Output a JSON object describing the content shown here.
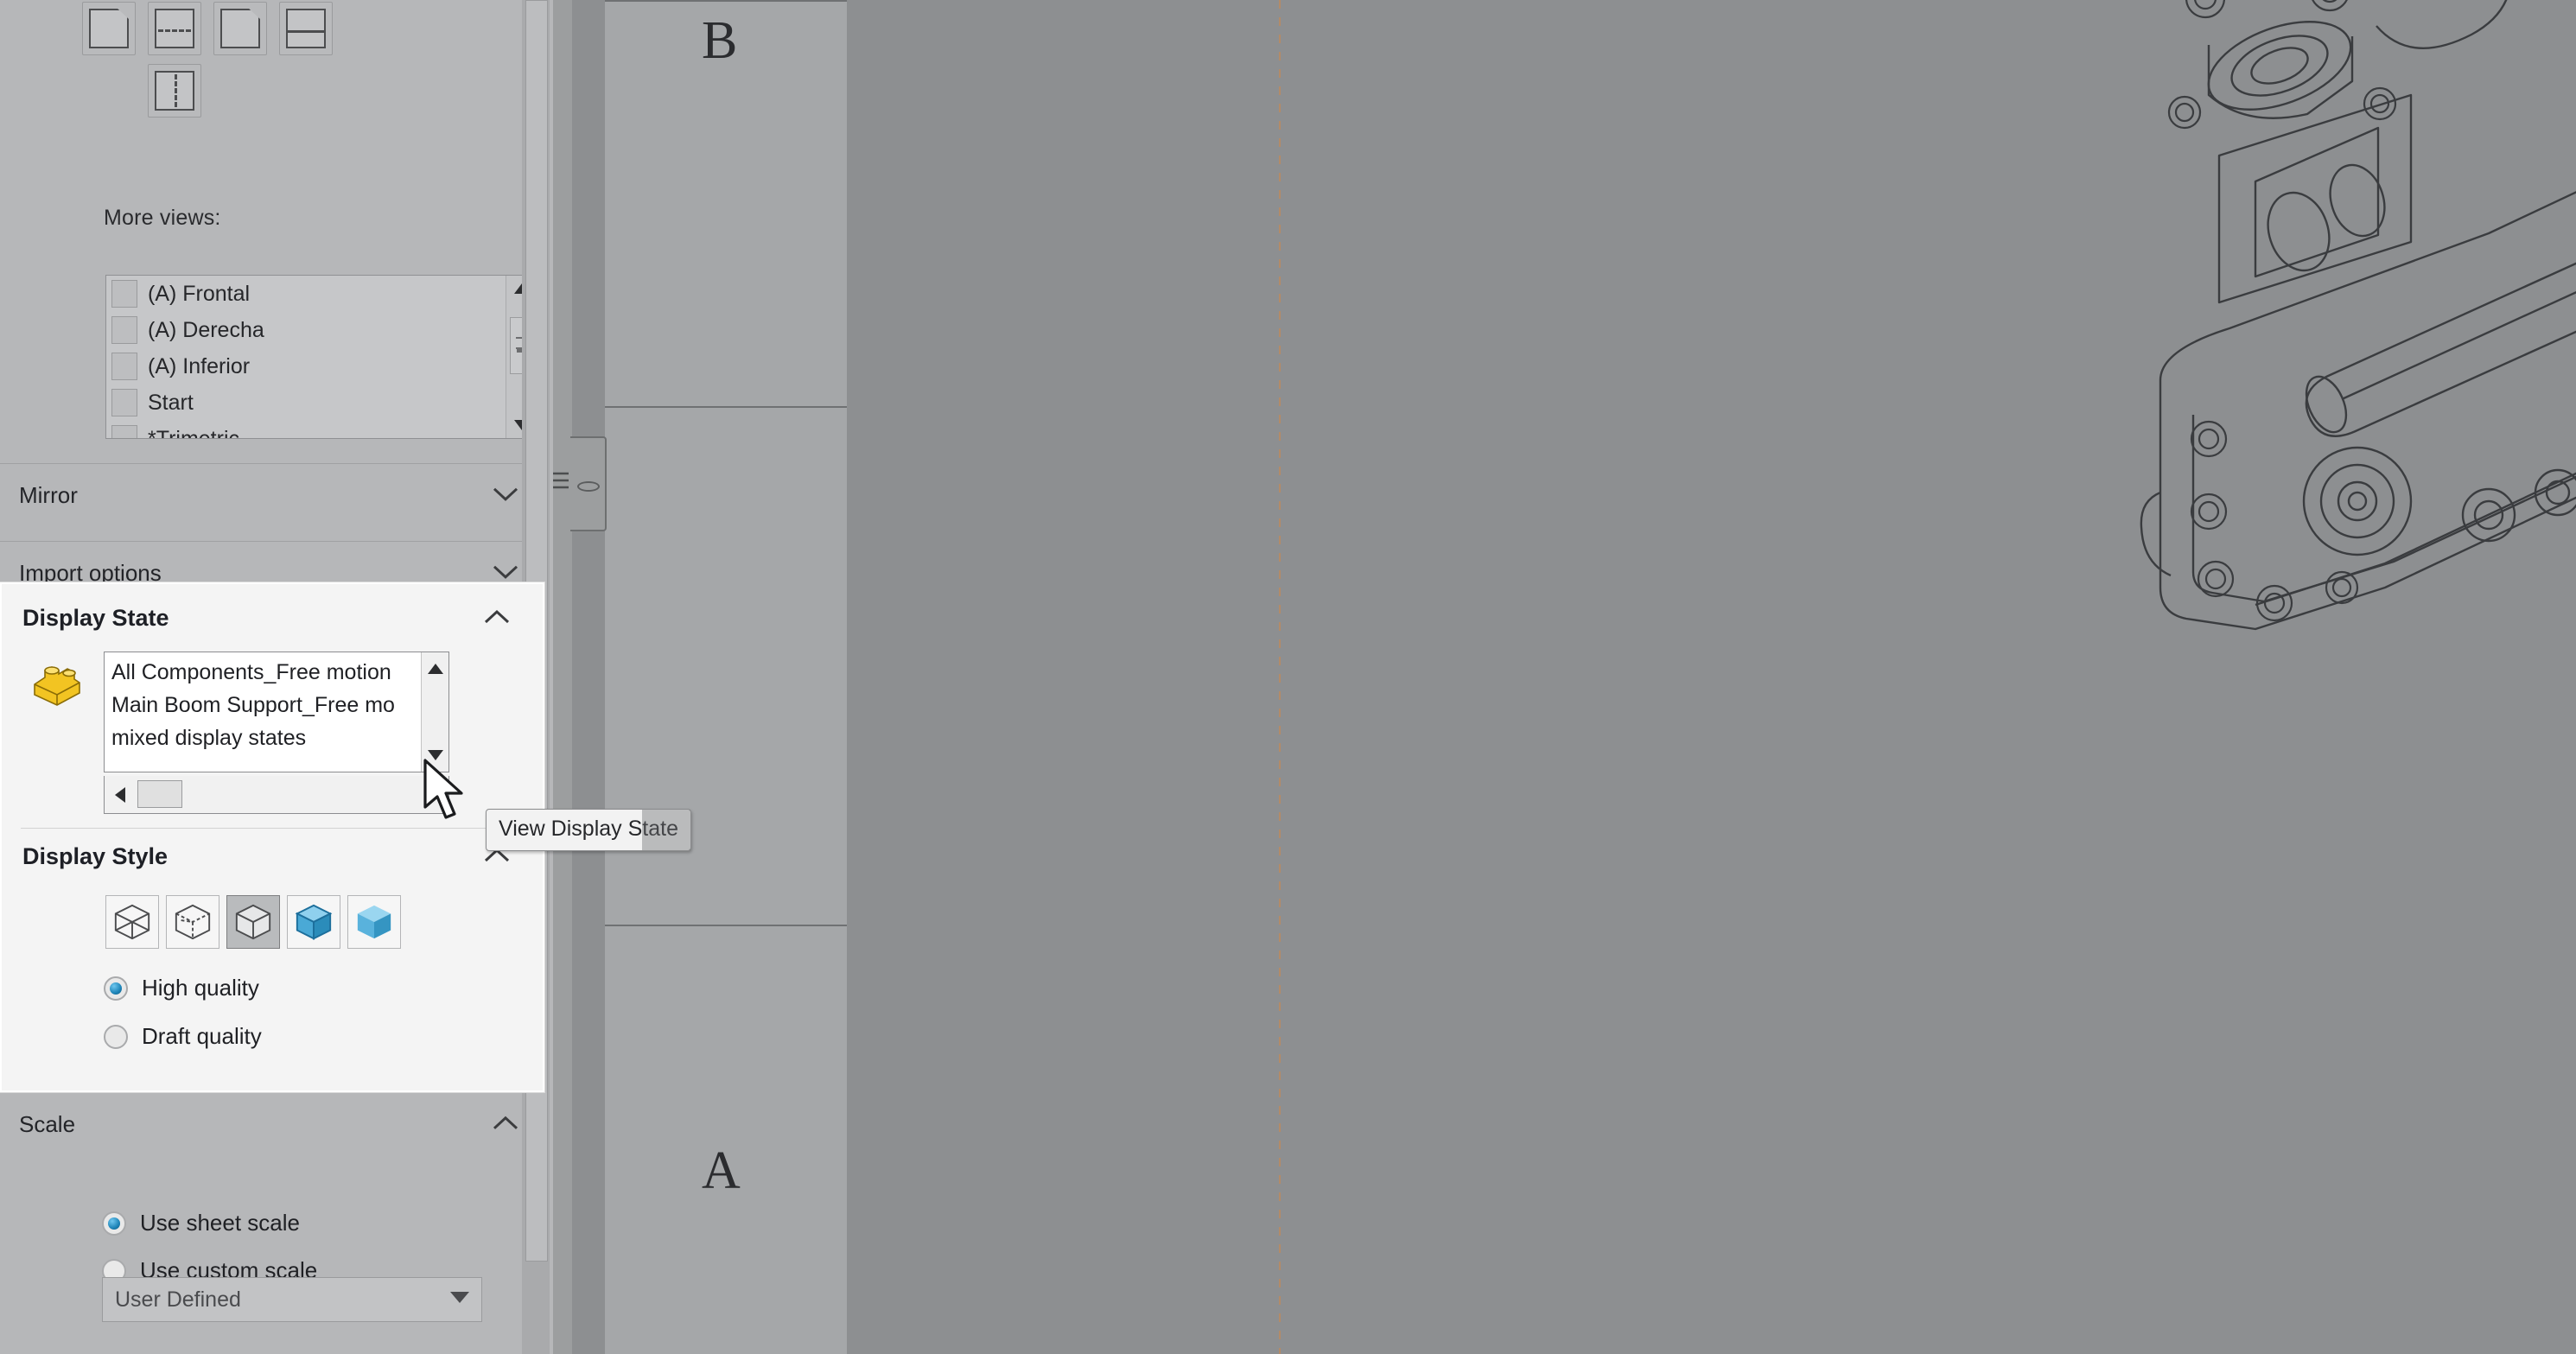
{
  "panel": {
    "more_views_label": "More views:",
    "views": [
      {
        "label": "(A) Frontal",
        "checked": false
      },
      {
        "label": "(A) Derecha",
        "checked": false
      },
      {
        "label": "(A) Inferior",
        "checked": false
      },
      {
        "label": "Start",
        "checked": false
      },
      {
        "label": "*Trimetric",
        "checked": false
      }
    ],
    "groups": [
      {
        "title": "Mirror",
        "expanded": false
      },
      {
        "title": "Import options",
        "expanded": false
      }
    ]
  },
  "display_state": {
    "title": "Display State",
    "icon": "display-state-lego-icon",
    "items": [
      "All Components_Free motion",
      "Main Boom Support_Free mo",
      "mixed display states"
    ],
    "selected_index": -1,
    "hscroll_position": "left"
  },
  "display_style": {
    "title": "Display Style",
    "buttons": [
      {
        "name": "wireframe",
        "active": false
      },
      {
        "name": "hidden-lines-visible",
        "active": false
      },
      {
        "name": "hidden-lines-removed",
        "active": true
      },
      {
        "name": "shaded-with-edges",
        "active": false
      },
      {
        "name": "shaded",
        "active": false
      }
    ],
    "quality": [
      {
        "label": "High quality",
        "selected": true
      },
      {
        "label": "Draft quality",
        "selected": false
      }
    ]
  },
  "scale": {
    "title": "Scale",
    "options": [
      {
        "label": "Use sheet scale",
        "selected": true
      },
      {
        "label": "Use custom scale",
        "selected": false
      }
    ],
    "custom_scale_value": "User Defined"
  },
  "tooltip": {
    "text": "View Display State"
  },
  "sheet": {
    "zone_labels": [
      "B",
      "A"
    ]
  },
  "colors": {
    "panel_bg": "#b6b7b9",
    "highlight_bg": "#f4f4f4",
    "sheet_bg": "#8d8f91",
    "accent_blue": "#1d84b8",
    "lego_yellow": "#f2c422",
    "dash_orange": "#c08a5a"
  }
}
